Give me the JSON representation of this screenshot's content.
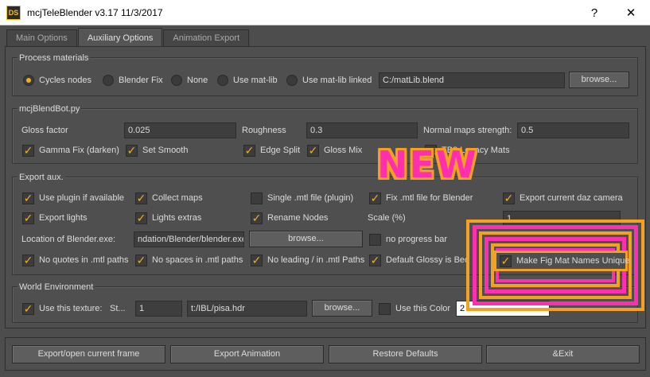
{
  "window": {
    "icon_text": "DS",
    "title": "mcjTeleBlender v3.17 11/3/2017",
    "help": "?",
    "close": "✕"
  },
  "tabs": [
    "Main Options",
    "Auxiliary Options",
    "Animation Export"
  ],
  "process_materials": {
    "title": "Process materials",
    "options": [
      "Cycles nodes",
      "Blender Fix",
      "None",
      "Use mat-lib",
      "Use mat-lib linked"
    ],
    "path": "C:/matLib.blend",
    "browse": "browse..."
  },
  "blendbot": {
    "title": "mcjBlendBot.py",
    "gloss_label": "Gloss factor",
    "gloss_value": "0.025",
    "roughness_label": "Roughness",
    "roughness_value": "0.3",
    "normal_label": "Normal maps strength:",
    "normal_value": "0.5",
    "checks": [
      "Gamma Fix (darken)",
      "Set Smooth",
      "Edge Split",
      "Gloss Mix",
      "TB2 Legacy Mats"
    ]
  },
  "export_aux": {
    "title": "Export aux.",
    "row1": [
      "Use plugin if available",
      "Collect maps",
      "Single .mtl file (plugin)",
      "Fix .mtl file for Blender",
      "Export current daz camera"
    ],
    "row2": [
      "Export lights",
      "Lights extras",
      "Rename Nodes"
    ],
    "scale_label": "Scale (%)",
    "scale_value": "1",
    "blender_label": "Location of Blender.exe:",
    "blender_path": "ndation/Blender/blender.exe",
    "browse": "browse...",
    "no_progress": "no progress bar",
    "row4": [
      "No quotes in .mtl paths",
      "No spaces in .mtl paths",
      "No leading / in .mtl Paths",
      "Default Glossy is Bec"
    ],
    "make_unique": "Make Fig Mat Names Unique"
  },
  "world": {
    "title": "World Environment",
    "use_texture": "Use this texture:",
    "st": "St...",
    "st_value": "1",
    "texture_path": "t:/IBL/pisa.hdr",
    "browse": "browse...",
    "use_color": "Use this Color",
    "color_value": "2"
  },
  "buttons": [
    "Export/open current frame",
    "Export Animation",
    "Restore Defaults",
    "&Exit"
  ],
  "overlay": {
    "new_text": "NEW"
  },
  "colors": {
    "accent": "#f0b020",
    "highlight_pink": "#ff2fb0",
    "highlight_orange": "#f4a020"
  }
}
